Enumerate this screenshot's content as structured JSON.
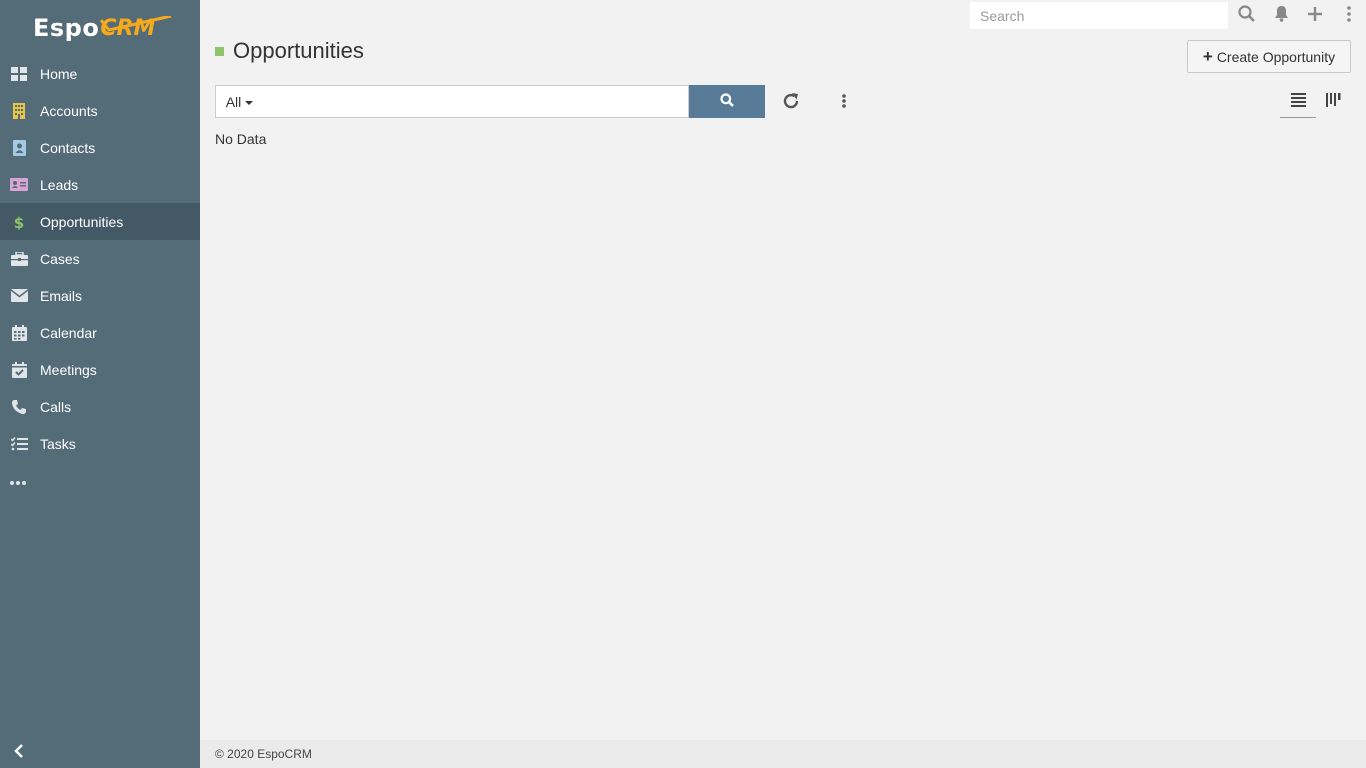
{
  "app": {
    "logo_primary": "Espo",
    "logo_secondary": "CRM",
    "brand_accent": "#f5a91c"
  },
  "sidebar": {
    "items": [
      {
        "label": "Home",
        "icon": "home-grid-icon",
        "color": "#ffffff"
      },
      {
        "label": "Accounts",
        "icon": "building-icon",
        "color": "#e8c546"
      },
      {
        "label": "Contacts",
        "icon": "contact-card-icon",
        "color": "#a5c8e6"
      },
      {
        "label": "Leads",
        "icon": "id-card-icon",
        "color": "#d8a4d6"
      },
      {
        "label": "Opportunities",
        "icon": "dollar-icon",
        "color": "#8ec46b",
        "active": true
      },
      {
        "label": "Cases",
        "icon": "briefcase-icon",
        "color": "#ffffff"
      },
      {
        "label": "Emails",
        "icon": "envelope-icon",
        "color": "#ffffff"
      },
      {
        "label": "Calendar",
        "icon": "calendar-icon",
        "color": "#ffffff"
      },
      {
        "label": "Meetings",
        "icon": "calendar-check-icon",
        "color": "#ffffff"
      },
      {
        "label": "Calls",
        "icon": "phone-icon",
        "color": "#ffffff"
      },
      {
        "label": "Tasks",
        "icon": "tasks-icon",
        "color": "#ffffff"
      }
    ],
    "more_icon": "ellipsis-icon",
    "collapse_icon": "chevron-left-icon"
  },
  "topbar": {
    "search_placeholder": "Search"
  },
  "page": {
    "title": "Opportunities",
    "title_accent": "#8ec46b",
    "create_button_label": "Create Opportunity"
  },
  "filters": {
    "preset_label": "All",
    "text_filter_value": "",
    "search_button_color": "#587b98"
  },
  "list": {
    "empty_text": "No Data"
  },
  "footer": {
    "text": "© 2020 EspoCRM"
  }
}
